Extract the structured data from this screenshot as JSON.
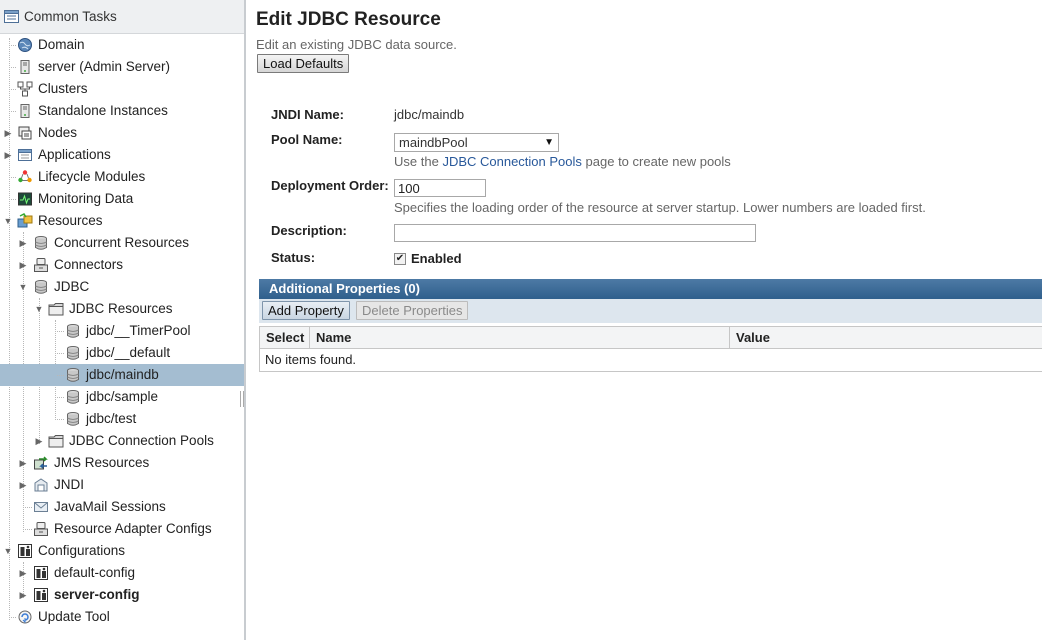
{
  "tree": {
    "header": "Common Tasks",
    "items": [
      {
        "label": "Domain"
      },
      {
        "label": "server (Admin Server)"
      },
      {
        "label": "Clusters"
      },
      {
        "label": "Standalone Instances"
      },
      {
        "label": "Nodes"
      },
      {
        "label": "Applications"
      },
      {
        "label": "Lifecycle Modules"
      },
      {
        "label": "Monitoring Data"
      },
      {
        "label": "Resources"
      },
      {
        "label": "Concurrent Resources"
      },
      {
        "label": "Connectors"
      },
      {
        "label": "JDBC"
      },
      {
        "label": "JDBC Resources"
      },
      {
        "label": "jdbc/__TimerPool"
      },
      {
        "label": "jdbc/__default"
      },
      {
        "label": "jdbc/maindb"
      },
      {
        "label": "jdbc/sample"
      },
      {
        "label": "jdbc/test"
      },
      {
        "label": "JDBC Connection Pools"
      },
      {
        "label": "JMS Resources"
      },
      {
        "label": "JNDI"
      },
      {
        "label": "JavaMail Sessions"
      },
      {
        "label": "Resource Adapter Configs"
      },
      {
        "label": "Configurations"
      },
      {
        "label": "default-config"
      },
      {
        "label": "server-config"
      },
      {
        "label": "Update Tool"
      }
    ]
  },
  "page": {
    "title": "Edit JDBC Resource",
    "description": "Edit an existing JDBC data source.",
    "load_defaults": "Load Defaults"
  },
  "form": {
    "jndi_label": "JNDI Name:",
    "jndi_value": "jdbc/maindb",
    "pool_label": "Pool Name:",
    "pool_value": "maindbPool",
    "pool_help_prefix": "Use the",
    "pool_help_link": "JDBC Connection Pools",
    "pool_help_suffix": "page to create new pools",
    "deploy_label": "Deployment Order:",
    "deploy_value": "100",
    "deploy_help": "Specifies the loading order of the resource at server startup. Lower numbers are loaded first.",
    "desc_label": "Description:",
    "desc_value": "",
    "status_label": "Status:",
    "status_text": "Enabled"
  },
  "props": {
    "header": "Additional Properties (0)",
    "add_button": "Add Property",
    "delete_button": "Delete Properties",
    "columns": [
      "Select",
      "Name",
      "Value"
    ],
    "empty": "No items found."
  },
  "icons": {
    "tree": [
      "globe-icon",
      "server-icon",
      "clusters-icon",
      "server-icon",
      "nodes-icon",
      "applications-icon",
      "lifecycle-icon",
      "monitor-icon",
      "resources-icon",
      "database-icon",
      "connector-icon",
      "database-icon",
      "folder-icon",
      "database-icon",
      "database-icon",
      "database-icon",
      "database-icon",
      "database-icon",
      "folder-icon",
      "jms-icon",
      "jndi-icon",
      "mail-icon",
      "connector-icon",
      "config-icon",
      "config-icon",
      "config-icon",
      "update-icon"
    ]
  },
  "colors": {
    "selected_row": "#a4bdd1",
    "props_header": "#3c6a96",
    "link": "#28589a"
  }
}
